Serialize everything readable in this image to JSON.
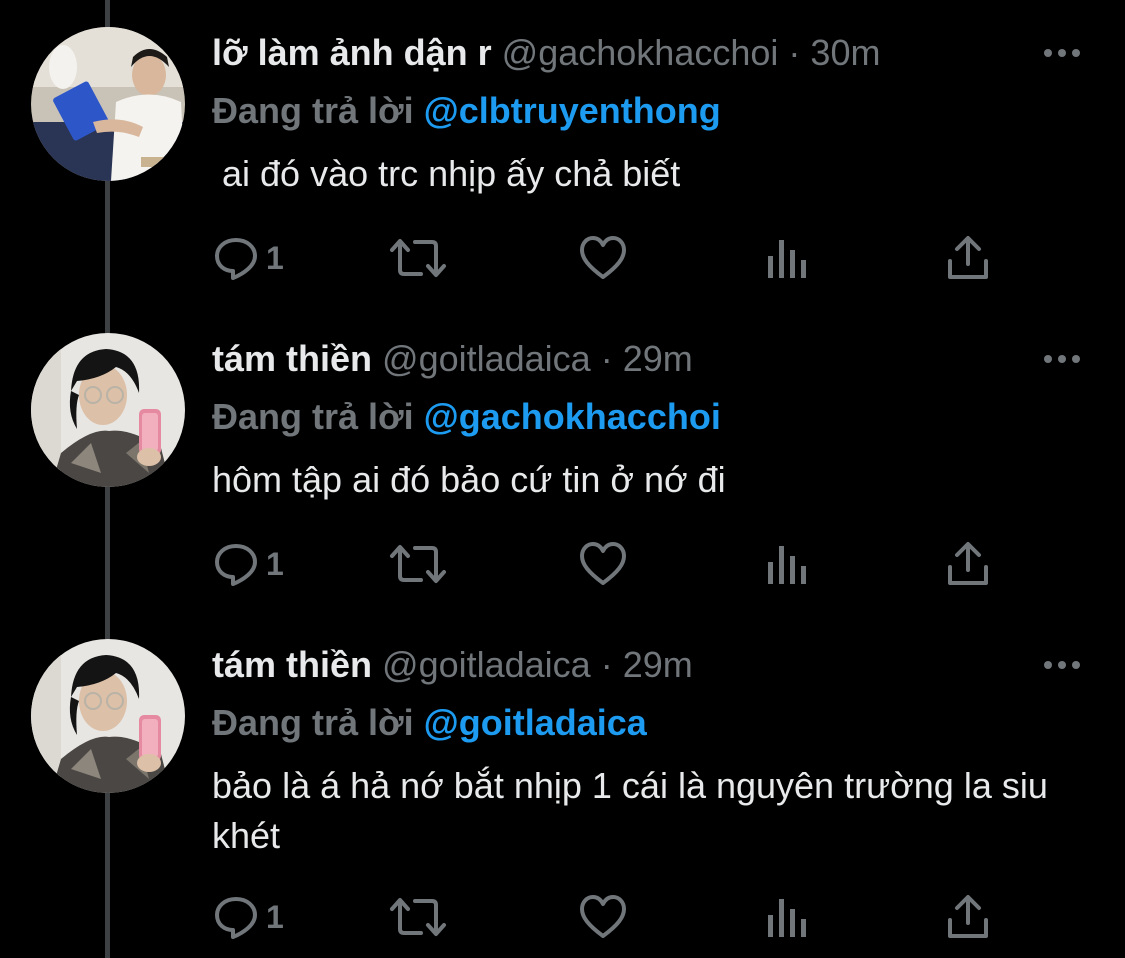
{
  "colors": {
    "background": "#000000",
    "primary_text": "#e7e9ea",
    "secondary_text": "#71767b",
    "mention": "#1d9bf0",
    "thread_line": "#3e4144"
  },
  "icons": {
    "more": "more-horizontal-icon",
    "reply": "reply-icon",
    "retweet": "retweet-icon",
    "like": "heart-icon",
    "views": "views-bar-chart-icon",
    "share": "share-icon"
  },
  "tweets": [
    {
      "display_name": "lỡ làm ảnh dận r",
      "handle": "@gachokhacchoi",
      "separator": "·",
      "time": "30m",
      "replying_label": "Đang trả lời",
      "replying_to": "@clbtruyenthong",
      "text": " ai đó vào trc nhịp ấy chả biết",
      "reply_count": "1"
    },
    {
      "display_name": "tám thiền",
      "handle": "@goitladaica",
      "separator": "·",
      "time": "29m",
      "replying_label": "Đang trả lời",
      "replying_to": "@gachokhacchoi",
      "text": "hôm tập ai đó bảo cứ tin ở nớ đi",
      "reply_count": "1"
    },
    {
      "display_name": "tám thiền",
      "handle": "@goitladaica",
      "separator": "·",
      "time": "29m",
      "replying_label": "Đang trả lời",
      "replying_to": "@goitladaica",
      "text": "bảo là á hả nớ bắt nhịp 1 cái là nguyên trường la siu khét",
      "reply_count": "1"
    }
  ]
}
